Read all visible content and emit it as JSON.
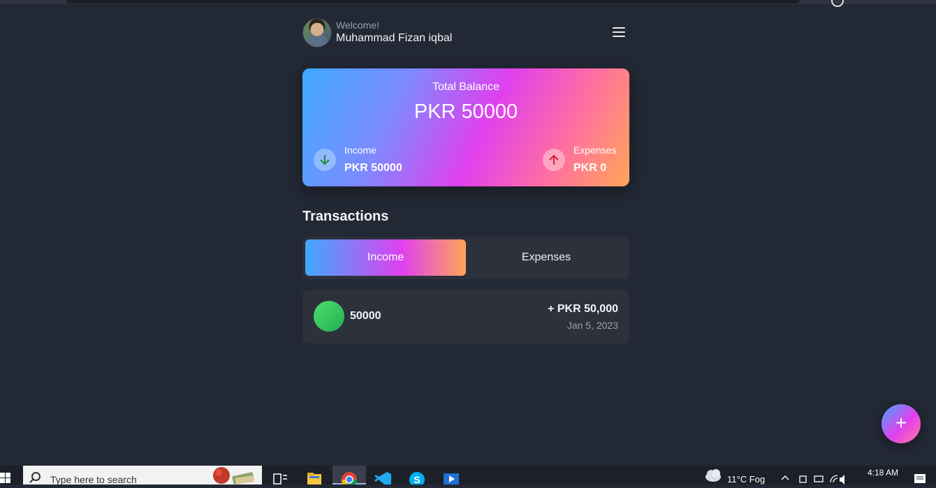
{
  "header": {
    "welcome": "Welcome!",
    "user_name": "Muhammad Fizan iqbal"
  },
  "balance": {
    "title": "Total Balance",
    "amount": "PKR 50000",
    "income_label": "Income",
    "income_value": "PKR 50000",
    "expenses_label": "Expenses",
    "expenses_value": "PKR 0"
  },
  "transactions": {
    "title": "Transactions",
    "tabs": [
      {
        "label": "Income",
        "active": true
      },
      {
        "label": "Expenses",
        "active": false
      }
    ],
    "items": [
      {
        "name": "50000",
        "amount": "+ PKR 50,000",
        "date": "Jan 5, 2023"
      }
    ]
  },
  "fab": {
    "label": "+"
  },
  "taskbar": {
    "search_placeholder": "Type here to search",
    "weather": "11°C  Fog",
    "time": "4:18 AM"
  },
  "colors": {
    "background": "#222834",
    "card": "#2c313c",
    "gradient_start": "#3fa9ff",
    "gradient_mid": "#e040ee",
    "gradient_end": "#ffa657",
    "income_arrow": "#1f8a3a",
    "expense_arrow": "#d0233a",
    "transaction_dot": "#2fc55a"
  },
  "icons": [
    "menu-icon",
    "arrow-down-icon",
    "arrow-up-icon",
    "plus-icon",
    "windows-start-icon",
    "search-icon"
  ]
}
